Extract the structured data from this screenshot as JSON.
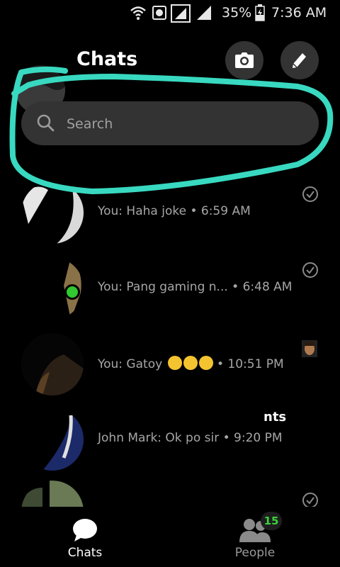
{
  "status_bar": {
    "battery_text": "35%",
    "time": "7:36 AM",
    "icons": [
      "wifi-icon",
      "data-saver-icon",
      "signal-icon-sim1",
      "signal-icon-sim2",
      "battery-charging-icon"
    ]
  },
  "header": {
    "title": "Chats",
    "camera_icon": "camera-icon",
    "compose_icon": "pencil-icon"
  },
  "search": {
    "placeholder": "Search",
    "value": ""
  },
  "conversations": [
    {
      "name": "",
      "message": "You: Haha joke • 6:59 AM",
      "status_icon": "check-circle-icon",
      "online": false
    },
    {
      "name": "",
      "message": "You: Pang gaming n... • 6:48 AM",
      "status_icon": "check-circle-icon",
      "online": true
    },
    {
      "name": "",
      "message_prefix": "You: Gatoy",
      "message_suffix": "• 10:51 PM",
      "status_icon": "seen-avatar-icon",
      "online": false
    },
    {
      "name": "nts",
      "message": "John Mark: Ok po sir • 9:20 PM",
      "status_icon": "",
      "online": false
    },
    {
      "name": "",
      "message": "",
      "status_icon": "check-circle-icon",
      "online": false
    }
  ],
  "tabs": [
    {
      "label": "Chats",
      "icon": "chat-bubble-icon",
      "active": true
    },
    {
      "label": "People",
      "icon": "people-icon",
      "active": false,
      "badge": "15"
    }
  ],
  "colors": {
    "background": "#000000",
    "search_bg": "#333333",
    "annotation": "#38d9c0",
    "online": "#32c832",
    "muted_text": "#a6a6a6"
  }
}
